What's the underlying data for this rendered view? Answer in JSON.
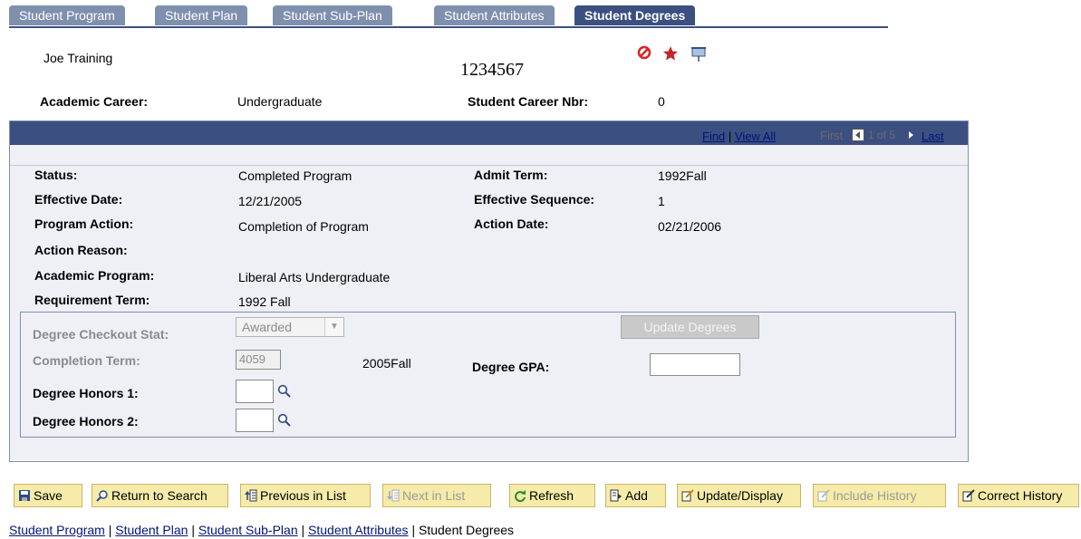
{
  "tabs": [
    {
      "label": "Student Program"
    },
    {
      "label": "Student Plan"
    },
    {
      "label": "Student Sub-Plan"
    },
    {
      "label": "Student Attributes"
    },
    {
      "label": "Student Degrees"
    }
  ],
  "student": {
    "name": "Joe Training",
    "id": "1234567",
    "academic_career_label": "Academic Career:",
    "academic_career": "Undergraduate",
    "career_nbr_label": "Student Career Nbr:",
    "career_nbr": "0"
  },
  "nav": {
    "find": "Find",
    "sep": " | ",
    "view_all": "View All",
    "first": "First",
    "page": "1 of 5",
    "last": "Last"
  },
  "details": {
    "status_label": "Status:",
    "status": "Completed Program",
    "admit_term_label": "Admit Term:",
    "admit_term": "1992Fall",
    "effective_date_label": "Effective Date:",
    "effective_date": "12/21/2005",
    "effective_seq_label": "Effective Sequence:",
    "effective_seq": "1",
    "program_action_label": "Program Action:",
    "program_action": "Completion of Program",
    "action_date_label": "Action Date:",
    "action_date": "02/21/2006",
    "action_reason_label": "Action Reason:",
    "academic_program_label": "Academic Program:",
    "academic_program": "Liberal Arts Undergraduate",
    "requirement_term_label": "Requirement Term:",
    "requirement_term": "1992 Fall"
  },
  "degree": {
    "checkout_label": "Degree Checkout Stat:",
    "checkout_value": "Awarded",
    "update_button": "Update Degrees",
    "completion_term_label": "Completion Term:",
    "completion_term_code": "4059",
    "completion_term_desc": "2005Fall",
    "gpa_label": "Degree GPA:",
    "gpa_value": "",
    "honors1_label": "Degree Honors 1:",
    "honors1_value": "",
    "honors2_label": "Degree Honors 2:",
    "honors2_value": ""
  },
  "toolbar": {
    "save": "Save",
    "return_search": "Return to Search",
    "prev_list": "Previous in List",
    "next_list": "Next in List",
    "refresh": "Refresh",
    "add": "Add",
    "update_display": "Update/Display",
    "include_history": "Include History",
    "correct_history": "Correct History"
  },
  "bottom_links": {
    "l1": "Student Program",
    "l2": "Student Plan",
    "l3": "Student Sub-Plan",
    "l4": "Student Attributes",
    "current": "Student Degrees",
    "sep": " | "
  },
  "colors": {
    "tab_active": "#3b4f80",
    "tab_inactive": "#7f8fae",
    "button_bg": "#f6eba8"
  }
}
